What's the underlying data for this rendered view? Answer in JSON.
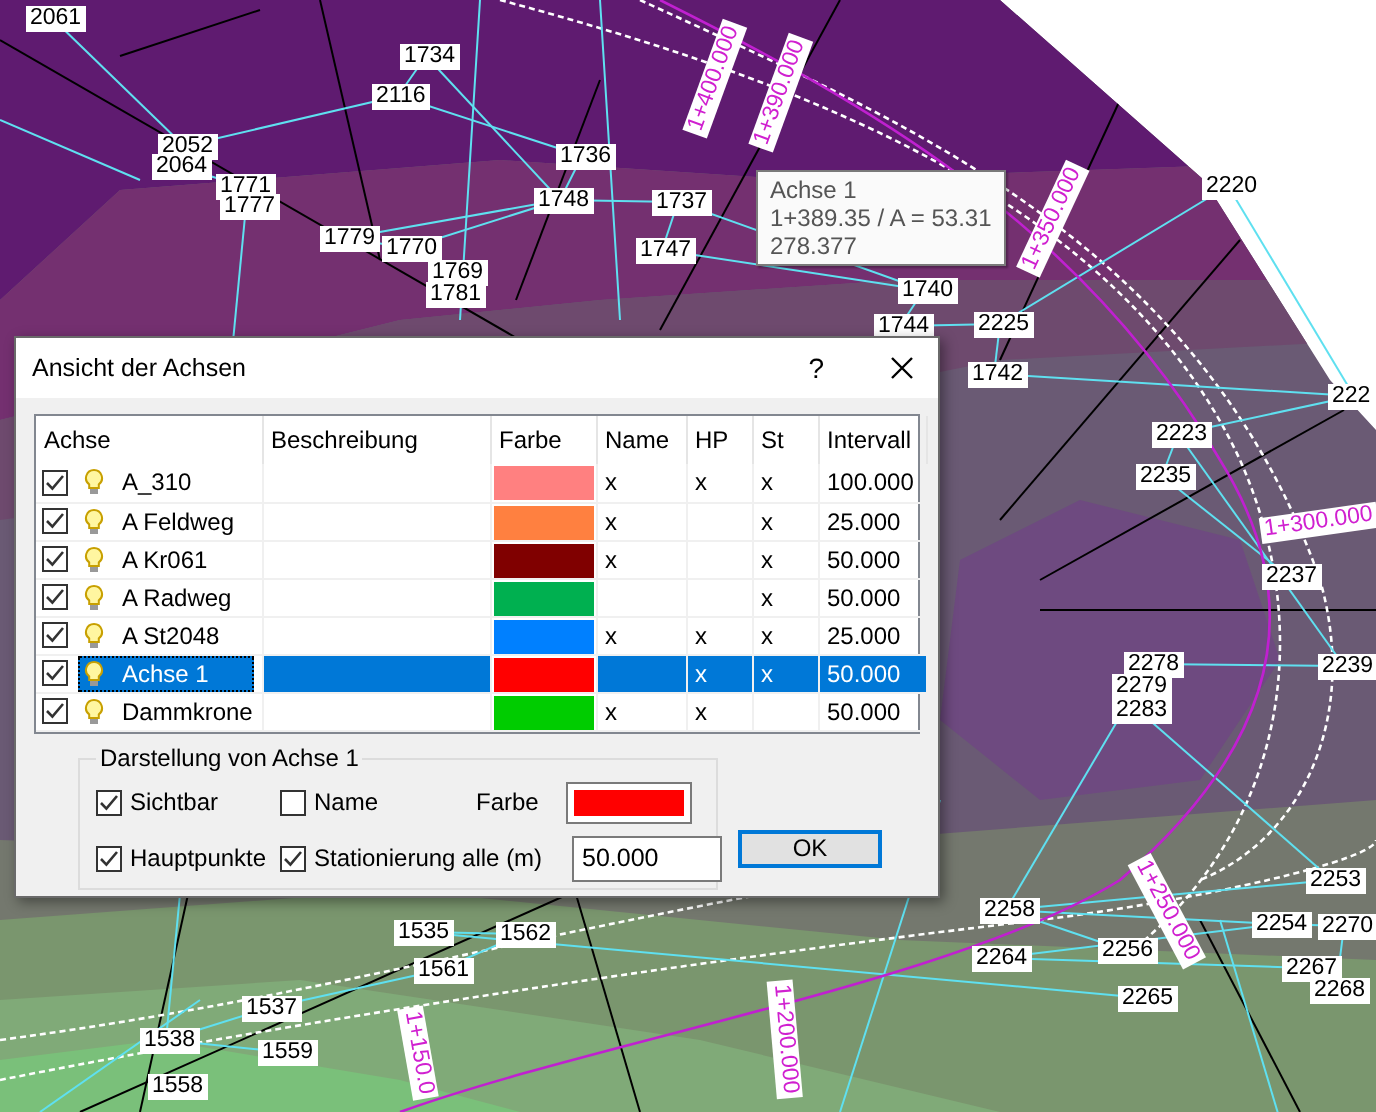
{
  "canvas": {
    "point_labels": [
      "2061",
      "1734",
      "2116",
      "2052",
      "2064",
      "1771",
      "1777",
      "1736",
      "1748",
      "1737",
      "1779",
      "1770",
      "1747",
      "1769",
      "1781",
      "1740",
      "1744",
      "2225",
      "1742",
      "2220",
      "222",
      "2223",
      "2235",
      "2237",
      "2239",
      "2278",
      "2279",
      "2283",
      "2253",
      "2258",
      "2254",
      "2270",
      "2256",
      "2264",
      "2267",
      "2268",
      "2265",
      "1535",
      "1562",
      "1561",
      "1537",
      "1538",
      "1559",
      "1558"
    ],
    "station_labels": [
      "1+400.000",
      "1+390.000",
      "1+350.000",
      "1+300.000",
      "1+250.000",
      "1+200.000",
      "1+150.0"
    ]
  },
  "tooltip": {
    "title": "Achse 1",
    "lines": [
      "1+389.35 / A = 53.31",
      "278.377"
    ]
  },
  "dialog": {
    "title": "Ansicht der Achsen",
    "help": "?",
    "columns": [
      "Achse",
      "Beschreibung",
      "Farbe",
      "Name",
      "HP",
      "St",
      "Intervall"
    ],
    "rows": [
      {
        "visible": true,
        "name": "A_310",
        "color": "#ff8080",
        "name_flag": "x",
        "hp": "x",
        "st": "x",
        "interval": "100.000",
        "selected": false
      },
      {
        "visible": true,
        "name": "A Feldweg",
        "color": "#ff8040",
        "name_flag": "x",
        "st": "x",
        "interval": "25.000",
        "selected": false
      },
      {
        "visible": true,
        "name": "A Kr061",
        "color": "#800000",
        "name_flag": "x",
        "st": "x",
        "interval": "50.000",
        "selected": false
      },
      {
        "visible": true,
        "name": "A Radweg",
        "color": "#00b050",
        "st": "x",
        "interval": "50.000",
        "selected": false
      },
      {
        "visible": true,
        "name": "A St2048",
        "color": "#0080ff",
        "name_flag": "x",
        "hp": "x",
        "st": "x",
        "interval": "25.000",
        "selected": false
      },
      {
        "visible": true,
        "name": "Achse 1",
        "color": "#ff0000",
        "hp": "x",
        "st": "x",
        "interval": "50.000",
        "selected": true
      },
      {
        "visible": true,
        "name": "Dammkrone",
        "color": "#00cc00",
        "name_flag": "x",
        "hp": "x",
        "interval": "50.000",
        "selected": false
      }
    ],
    "group": {
      "title": "Darstellung von Achse 1",
      "options": [
        {
          "label": "Sichtbar",
          "checked": true
        },
        {
          "label": "Name",
          "checked": false
        },
        {
          "label": "Hauptpunkte",
          "checked": true
        },
        {
          "label": "Stationierung alle (m)",
          "checked": true
        }
      ],
      "color_label": "Farbe",
      "color": "#ff0000",
      "interval_value": "50.000"
    },
    "ok_button": "OK"
  }
}
